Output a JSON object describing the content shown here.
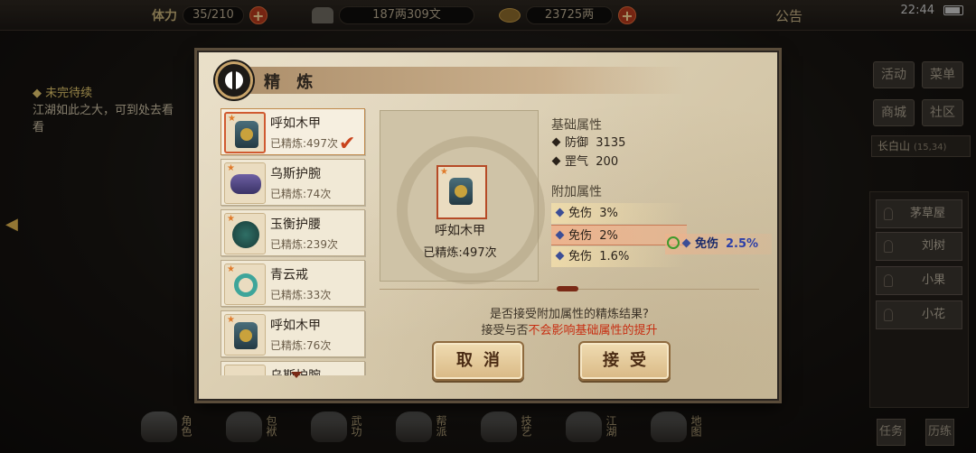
{
  "topbar": {
    "stamina_label": "体力",
    "stamina_value": "35/210",
    "silver_value": "187两309文",
    "gold_value": "23725两",
    "notice": "公告",
    "time": "22:44"
  },
  "quest": {
    "title": "未完待续",
    "desc": "江湖如此之大，可到处去看看"
  },
  "right_menu": {
    "buttons": [
      "活动",
      "菜单",
      "商城",
      "社区"
    ],
    "location": "长白山",
    "coords": "(15,34)",
    "npcs": [
      "茅草屋",
      "刘树",
      "小果",
      "小花"
    ]
  },
  "bottom_menu": [
    "角色",
    "包袱",
    "武功",
    "帮派",
    "技艺",
    "江湖",
    "地图"
  ],
  "bottom_right": [
    "任务",
    "历练"
  ],
  "dialog": {
    "title": "精 炼",
    "items": [
      {
        "name": "呼如木甲",
        "count": "已精炼:497次",
        "icon": "armor-icon",
        "selected": true
      },
      {
        "name": "乌斯护腕",
        "count": "已精炼:74次",
        "icon": "bracer-icon",
        "selected": false
      },
      {
        "name": "玉衡护腰",
        "count": "已精炼:239次",
        "icon": "belt-icon",
        "selected": false
      },
      {
        "name": "青云戒",
        "count": "已精炼:33次",
        "icon": "ring-icon",
        "selected": false
      },
      {
        "name": "呼如木甲",
        "count": "已精炼:76次",
        "icon": "armor-icon",
        "selected": false
      },
      {
        "name": "乌斯护腕",
        "count": "",
        "icon": "bracer-icon",
        "selected": false
      }
    ],
    "preview": {
      "name": "呼如木甲",
      "count": "已精炼:497次"
    },
    "base_title": "基础属性",
    "base_stats": [
      {
        "label": "防御",
        "value": "3135"
      },
      {
        "label": "罡气",
        "value": "200"
      }
    ],
    "extra_title": "附加属性",
    "extra_stats": [
      {
        "label": "免伤",
        "value": "3%"
      },
      {
        "label": "免伤",
        "value": "2%"
      },
      {
        "label": "免伤",
        "value": "1.6%"
      }
    ],
    "new_stat": {
      "label": "免伤",
      "value": "2.5%"
    },
    "question": "是否接受附加属性的精炼结果?",
    "note_prefix": "接受与否",
    "note_highlight": "不会影响基础属性的提升",
    "cancel_label": "取消",
    "accept_label": "接受"
  },
  "colors": {
    "accent_red": "#c72e12",
    "stat_blue": "#2c3fa8",
    "parchment": "#d9ccaf"
  }
}
